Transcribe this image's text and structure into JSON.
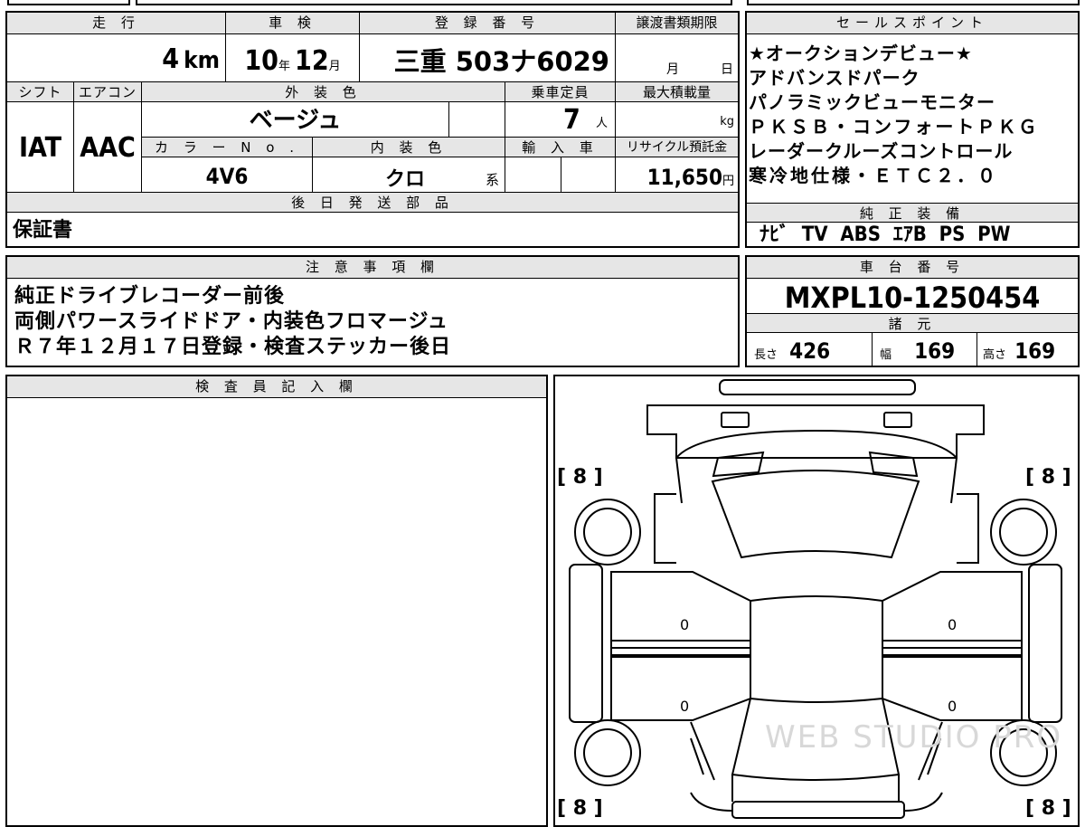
{
  "mileage": {
    "label": "走 行",
    "value": "4",
    "unit": "km"
  },
  "inspection": {
    "label": "車 検",
    "year": "10",
    "year_unit": "年",
    "month": "12",
    "month_unit": "月"
  },
  "registration": {
    "label": "登 録 番 号",
    "value": "三重 503ナ6029"
  },
  "transfer_deadline": {
    "label": "譲渡書類期限",
    "month_unit": "月",
    "day_unit": "日"
  },
  "sales_points": {
    "label": "セールスポイント",
    "lines": [
      "★オークションデビュー★",
      "アドバンスドパーク",
      "パノラミックビューモニター",
      "ＰＫＳＢ・コンフォートＰＫＧ",
      "レーダークルーズコントロール",
      "寒冷地仕様・ＥＴＣ２．０"
    ]
  },
  "shift": {
    "label": "シフト",
    "value": "IAT"
  },
  "aircon": {
    "label": "エアコン",
    "value": "AAC"
  },
  "exterior_color": {
    "label": "外 装 色",
    "value": "ベージュ"
  },
  "capacity": {
    "label": "乗車定員",
    "value": "7",
    "unit": "人"
  },
  "max_load": {
    "label": "最大積載量",
    "unit": "kg"
  },
  "color_no": {
    "label": "カ ラ ー N o .",
    "value": "4V6"
  },
  "interior_color": {
    "label": "内 装 色",
    "value": "クロ",
    "suffix": "系"
  },
  "import": {
    "label": "輸 入 車"
  },
  "recycle": {
    "label": "リサイクル預託金",
    "value": "11,650",
    "unit": "円"
  },
  "later_parts": {
    "label": "後 日 発 送 部 品",
    "value": "保証書"
  },
  "genuine_equipment": {
    "label": "純 正 装 備",
    "value": "ﾅﾋﾞ  TV  ABS  ｴｱB  PS  PW"
  },
  "notes": {
    "label": "注 意 事 項 欄",
    "lines": [
      "純正ドライブレコーダー前後",
      "両側パワースライドドア・内装色フロマージュ",
      "Ｒ７年１２月１７日登録・検査ステッカー後日"
    ]
  },
  "chassis": {
    "label": "車 台 番 号",
    "value": "MXPL10-1250454"
  },
  "specs": {
    "label": "諸 元",
    "length_label": "長さ",
    "length": "426",
    "width_label": "幅",
    "width": "169",
    "height_label": "高さ",
    "height": "169"
  },
  "inspector": {
    "label": "検 査 員 記 入 欄"
  },
  "diagram": {
    "tire_fl": "[ 8 ]",
    "tire_fr": "[ 8 ]",
    "tire_rl": "[ 8 ]",
    "tire_rr": "[ 8 ]",
    "door_mark": "0",
    "watermark": "WEB STUDIO PRO"
  }
}
